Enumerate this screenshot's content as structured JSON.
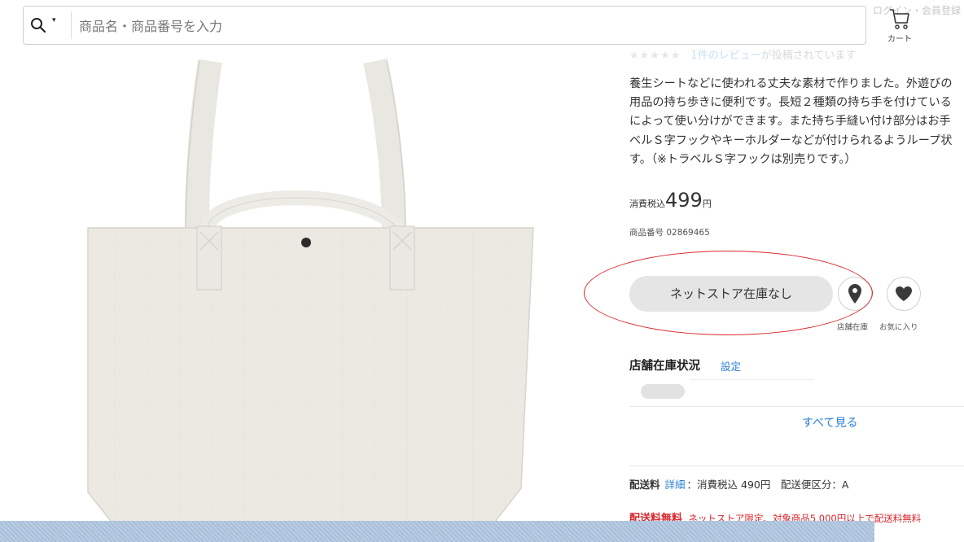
{
  "search": {
    "placeholder": "商品名・商品番号を入力",
    "scope_icon": "search-icon",
    "caret": "▾"
  },
  "header": {
    "faded_text": "ログイン・会員登録",
    "cart_label": "カート",
    "cart_icon": "cart-icon"
  },
  "product": {
    "image_alt": "tote-bag",
    "stars": "★★★★★",
    "review_link": "1件のレビュー",
    "review_text": "が投稿されています",
    "description_lines": [
      "養生シートなどに使われる丈夫な素材で作りました。外遊びの",
      "用品の持ち歩きに便利です。長短２種類の持ち手を付けている",
      "によって使い分けができます。また持ち手縫い付け部分はお手",
      "ベルＳ字フックやキーホルダーなどが付けられるようループ状",
      "す。（※トラベルＳ字フックは別売りです。）"
    ],
    "price_prefix": "消費税込",
    "price": "499",
    "price_unit": "円",
    "item_number": "商品番号 02869465"
  },
  "actions": {
    "stock_button": "ネットストア在庫なし",
    "store_stock_caption": "店舗在庫",
    "favorite_caption": "お気に入り",
    "store_icon": "map-pin-icon",
    "favorite_icon": "heart-icon"
  },
  "store_stock": {
    "title": "店舗在庫状況",
    "setting_link": "設定",
    "see_all": "すべて見る"
  },
  "shipping": {
    "label": "配送料",
    "detail_link": "詳細",
    "text": "：消費税込 490円　配送便区分：A"
  },
  "free_shipping": {
    "label": "配送料無料",
    "text": "ネットストア限定、対象商品5,000円以上で配送料無料"
  },
  "colors": {
    "link_blue": "#2a7fd4",
    "annotation_red": "#d8262c",
    "button_gray": "#e5e5e5"
  }
}
